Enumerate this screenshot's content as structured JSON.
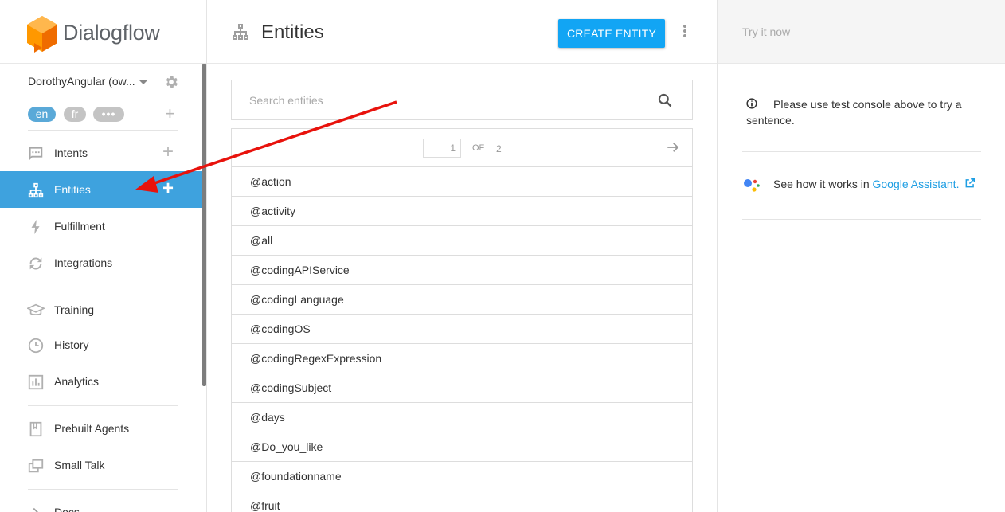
{
  "brand": {
    "name": "Dialogflow"
  },
  "agent": {
    "name": "DorothyAngular (ow..."
  },
  "languages": [
    "en",
    "fr",
    "•••"
  ],
  "nav": {
    "intents": "Intents",
    "entities": "Entities",
    "fulfillment": "Fulfillment",
    "integrations": "Integrations",
    "training": "Training",
    "history": "History",
    "analytics": "Analytics",
    "prebuilt": "Prebuilt Agents",
    "smalltalk": "Small Talk",
    "docs": "Docs"
  },
  "page": {
    "title": "Entities",
    "create_label": "CREATE ENTITY",
    "search_placeholder": "Search entities",
    "pager": {
      "current": "1",
      "of_label": "OF",
      "total": "2"
    },
    "entities": [
      "@action",
      "@activity",
      "@all",
      "@codingAPIService",
      "@codingLanguage",
      "@codingOS",
      "@codingRegexExpression",
      "@codingSubject",
      "@days",
      "@Do_you_like",
      "@foundationname",
      "@fruit"
    ]
  },
  "right_panel": {
    "try_now": "Try it now",
    "info": "Please use test console above to try a sentence.",
    "ga_prefix": "See how it works in ",
    "ga_link": "Google Assistant",
    "ga_suffix": "."
  },
  "colors": {
    "accent": "#3ea2de",
    "button": "#12a5f4",
    "annotation_arrow": "#e8120c"
  }
}
